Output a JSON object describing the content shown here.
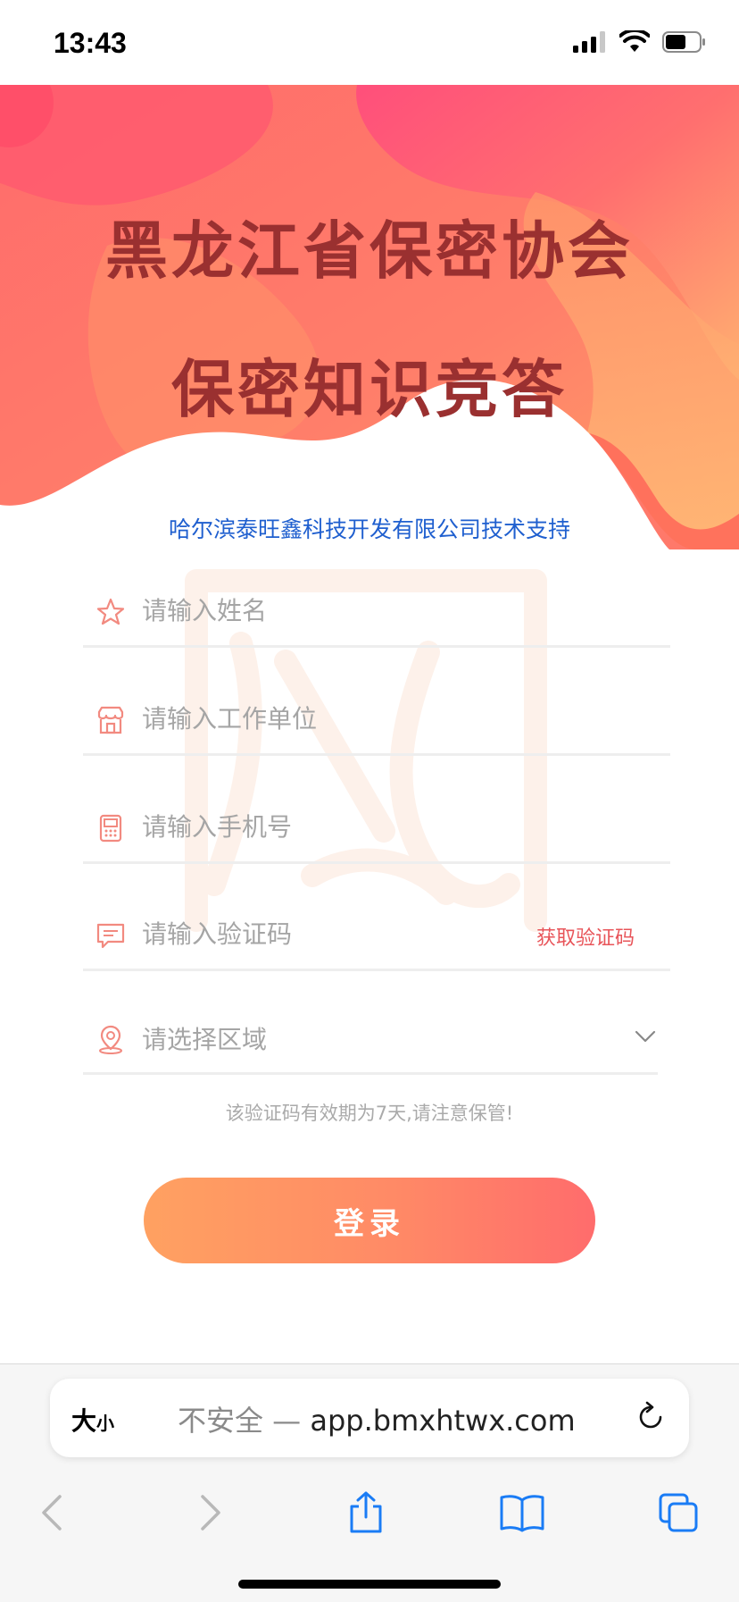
{
  "status_bar": {
    "time": "13:43"
  },
  "hero": {
    "title_line1": "黑龙江省保密协会",
    "title_line2": "保密知识竞答",
    "support_text": "哈尔滨泰旺鑫科技开发有限公司技术支持"
  },
  "form": {
    "name_placeholder": "请输入姓名",
    "work_unit_placeholder": "请输入工作单位",
    "phone_placeholder": "请输入手机号",
    "code_placeholder": "请输入验证码",
    "get_code_label": "获取验证码",
    "region_placeholder": "请选择区域",
    "hint": "该验证码有效期为7天,请注意保管!",
    "login_label": "登录"
  },
  "safari": {
    "text_size_label_big": "大",
    "text_size_label_small": "小",
    "insecure_label": "不安全 — ",
    "domain": "app.bmxhtwx.com"
  },
  "colors": {
    "title": "#9a3030",
    "support_link": "#1f5fcf",
    "accent_red": "#e8555a",
    "button_start": "#ffa161",
    "button_end": "#ff6c6c"
  }
}
